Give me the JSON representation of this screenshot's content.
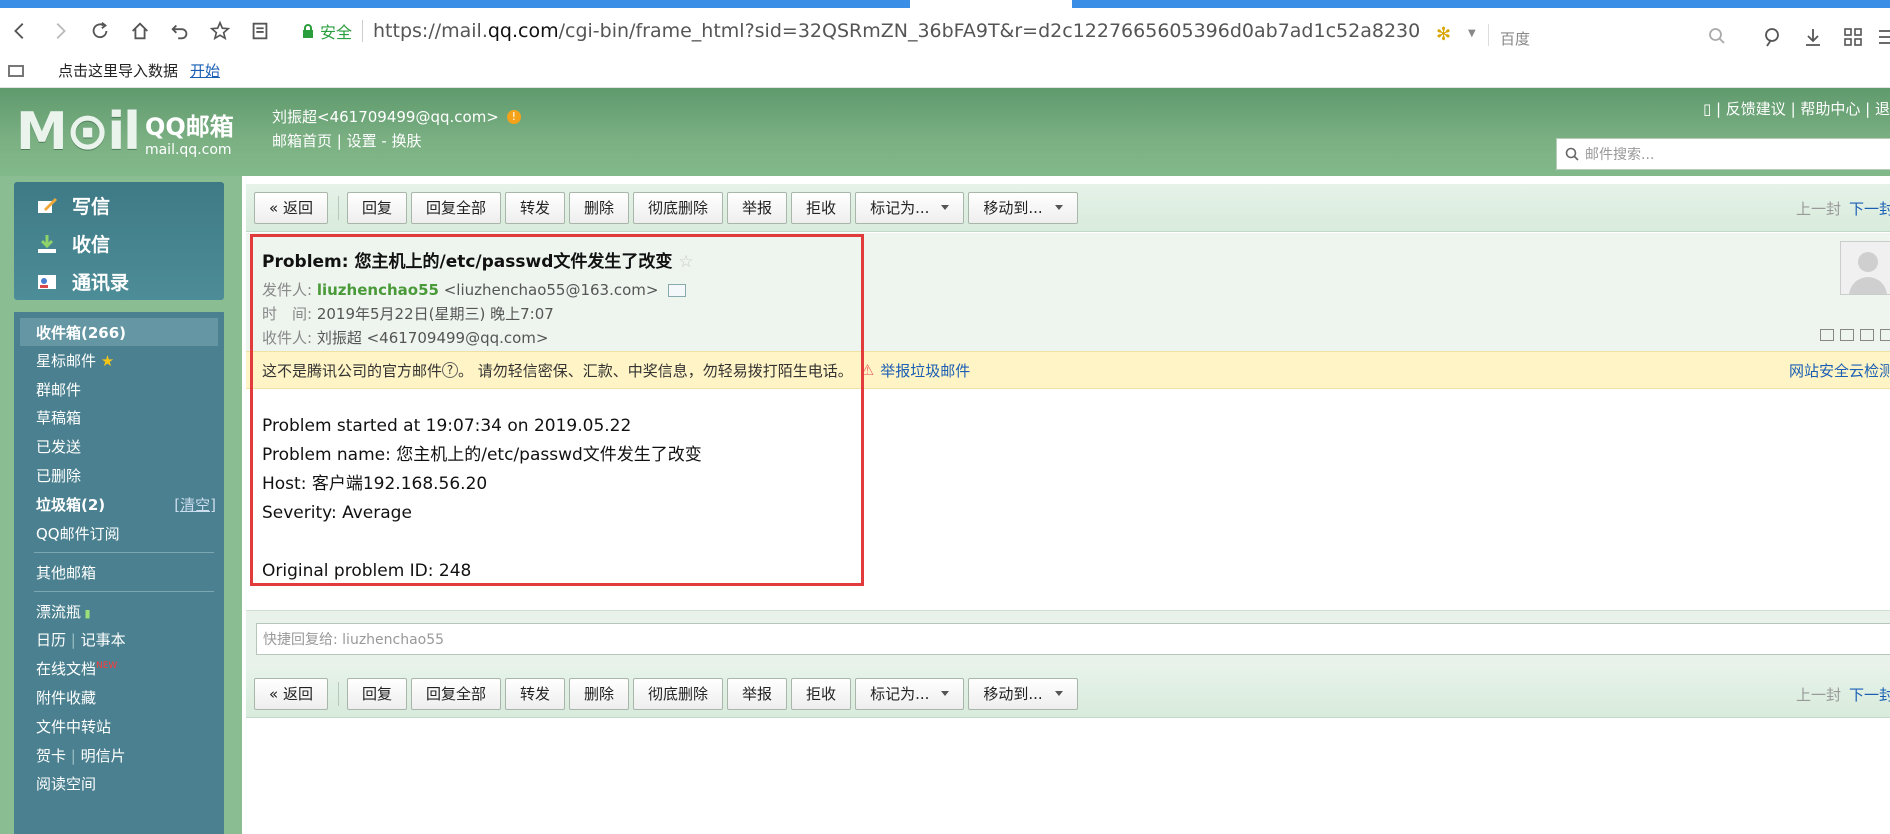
{
  "browser": {
    "secure_label": "安全",
    "url_prefix": "https://mail.",
    "url_domain": "qq.com",
    "url_suffix": "/cgi-bin/frame_html?sid=32QSRmZN_36bFA9T&r=d2c1227665605396d0ab7ad1c52a8230",
    "search_engine": "百度"
  },
  "bookmarks": {
    "import_text": "点击这里导入数据",
    "start_link": "开始"
  },
  "header": {
    "logo_mark": "M⊙il",
    "logo_name": "QQ邮箱",
    "logo_domain": "mail.qq.com",
    "user": "刘振超<461709499@qq.com>",
    "user_links": "邮箱首页 | 设置 - 换肤",
    "top_right": "| 反馈建议 | 帮助中心 | 退",
    "search_placeholder": "邮件搜索..."
  },
  "sidebar": {
    "compose": "写信",
    "inbox_action": "收信",
    "contacts": "通讯录",
    "folders": {
      "inbox": "收件箱(266)",
      "starred": "星标邮件",
      "group": "群邮件",
      "drafts": "草稿箱",
      "sent": "已发送",
      "deleted": "已删除",
      "spam": "垃圾箱(2)",
      "spam_clear": "[清空]",
      "subscriptions": "QQ邮件订阅",
      "other": "其他邮箱",
      "bottle": "漂流瓶",
      "calendar": "日历",
      "notes": "记事本",
      "docs": "在线文档",
      "docs_badge": "NEW",
      "attachments": "附件收藏",
      "transfer": "文件中转站",
      "cards": "贺卡",
      "postcards": "明信片",
      "reading": "阅读空间"
    }
  },
  "toolbar": {
    "back": "« 返回",
    "reply": "回复",
    "reply_all": "回复全部",
    "forward": "转发",
    "delete": "删除",
    "delete_perm": "彻底删除",
    "report": "举报",
    "reject": "拒收",
    "mark_as": "标记为...",
    "move_to": "移动到...",
    "prev": "上一封",
    "next": "下一封"
  },
  "mail": {
    "subject": "Problem: 您主机上的/etc/passwd文件发生了改变",
    "from_label": "发件人:",
    "from_name": "liuzhenchao55",
    "from_addr": "<liuzhenchao55@163.com>",
    "time_label": "时　间:",
    "time_value": "2019年5月22日(星期三) 晚上7:07",
    "to_label": "收件人:",
    "to_value": "刘振超 <461709499@qq.com>",
    "notice": "这不是腾讯公司的官方邮件",
    "notice_warn": "。  请勿轻信密保、汇款、中奖信息，勿轻易拨打陌生电话。",
    "report_spam": "举报垃圾邮件",
    "cloud_check": "网站安全云检测",
    "body": "Problem started at 19:07:34 on 2019.05.22\nProblem name: 您主机上的/etc/passwd文件发生了改变\nHost: 客户端192.168.56.20\nSeverity: Average\n\nOriginal problem ID: 248",
    "quick_reply_placeholder": "快捷回复给: liuzhenchao55"
  }
}
